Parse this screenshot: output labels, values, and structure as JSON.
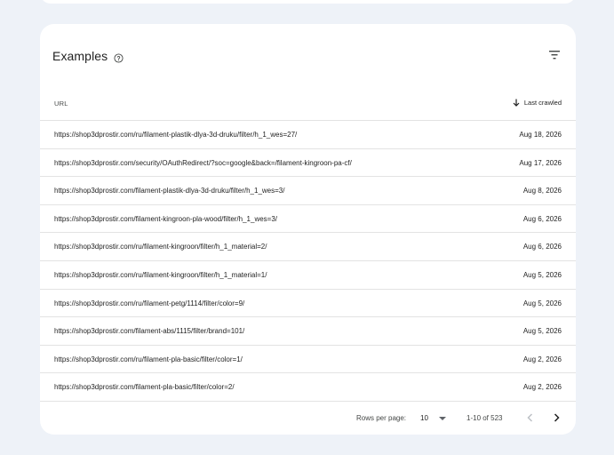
{
  "card": {
    "title": "Examples",
    "help_icon": "help-circle-icon",
    "filter_icon": "filter-icon"
  },
  "table": {
    "columns": {
      "url": "URL",
      "last_crawled": "Last crawled"
    },
    "sort_icon": "arrow-down-icon",
    "rows": [
      {
        "url": "https://shop3dprostir.com/ru/filament-plastik-dlya-3d-druku/filter/h_1_wes=27/",
        "date": "Aug 18, 2026"
      },
      {
        "url": "https://shop3dprostir.com/security/OAuthRedirect/?soc=google&back=/filament-kingroon-pa-cf/",
        "date": "Aug 17, 2026"
      },
      {
        "url": "https://shop3dprostir.com/filament-plastik-dlya-3d-druku/filter/h_1_wes=3/",
        "date": "Aug 8, 2026"
      },
      {
        "url": "https://shop3dprostir.com/filament-kingroon-pla-wood/filter/h_1_wes=3/",
        "date": "Aug 6, 2026"
      },
      {
        "url": "https://shop3dprostir.com/ru/filament-kingroon/filter/h_1_material=2/",
        "date": "Aug 6, 2026"
      },
      {
        "url": "https://shop3dprostir.com/ru/filament-kingroon/filter/h_1_material=1/",
        "date": "Aug 5, 2026"
      },
      {
        "url": "https://shop3dprostir.com/ru/filament-petg/1114/filter/color=9/",
        "date": "Aug 5, 2026"
      },
      {
        "url": "https://shop3dprostir.com/filament-abs/1115/filter/brand=101/",
        "date": "Aug 5, 2026"
      },
      {
        "url": "https://shop3dprostir.com/ru/filament-pla-basic/filter/color=1/",
        "date": "Aug 2, 2026"
      },
      {
        "url": "https://shop3dprostir.com/filament-pla-basic/filter/color=2/",
        "date": "Aug 2, 2026"
      }
    ]
  },
  "pagination": {
    "rows_per_page_label": "Rows per page:",
    "rows_per_page_value": "10",
    "range": "1-10 of 523",
    "prev_icon": "chevron-left-icon",
    "next_icon": "chevron-right-icon"
  },
  "colors": {
    "background": "#eef2f8",
    "card": "#ffffff",
    "divider": "#e3e3e3",
    "text": "#1f1f1f",
    "muted": "#444746",
    "disabled": "#bdc1c6"
  }
}
